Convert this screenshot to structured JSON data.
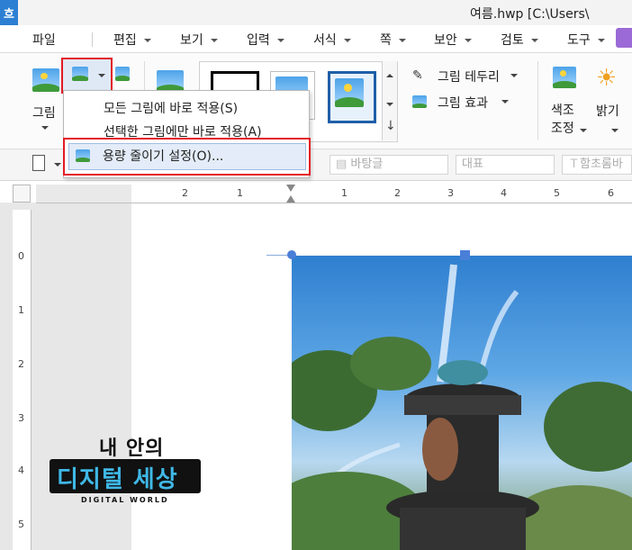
{
  "window": {
    "app_icon_glyph": "흐",
    "title": "여름.hwp [C:\\Users\\"
  },
  "menu": {
    "items": [
      {
        "label": "파일"
      },
      {
        "label": "편집"
      },
      {
        "label": "보기"
      },
      {
        "label": "입력"
      },
      {
        "label": "서식"
      },
      {
        "label": "쪽"
      },
      {
        "label": "보안"
      },
      {
        "label": "검토"
      },
      {
        "label": "도구"
      }
    ]
  },
  "ribbon": {
    "picture_label": "그림",
    "border_label": "그림 테두리",
    "effect_label": "그림 효과",
    "color_adjust_label": "색조\n조정",
    "color_adjust_line1": "색조",
    "color_adjust_line2": "조정",
    "brightness_label": "밝기"
  },
  "dropdown": {
    "items": [
      {
        "label": "모든 그림에 바로 적용(S)"
      },
      {
        "label": "선택한 그림에만 바로 적용(A)"
      },
      {
        "label": "용량 줄이기 설정(O)..."
      }
    ]
  },
  "format_bar": {
    "style_value": "바탕글",
    "representative_value": "대표",
    "font_value": "함초롬바"
  },
  "ruler": {
    "h_ticks": [
      "2",
      "1",
      "1",
      "2",
      "3",
      "4",
      "5",
      "6"
    ],
    "v_ticks": [
      "0",
      "1",
      "2",
      "3",
      "4",
      "5"
    ]
  },
  "logo": {
    "top_text": "내 안의",
    "main_text": "디지털 세상",
    "sub_text": "DIGITAL WORLD"
  },
  "colors": {
    "highlight_red": "#e31b23",
    "selection_blue": "#4a7fd8",
    "app_blue": "#2d7fd3"
  }
}
